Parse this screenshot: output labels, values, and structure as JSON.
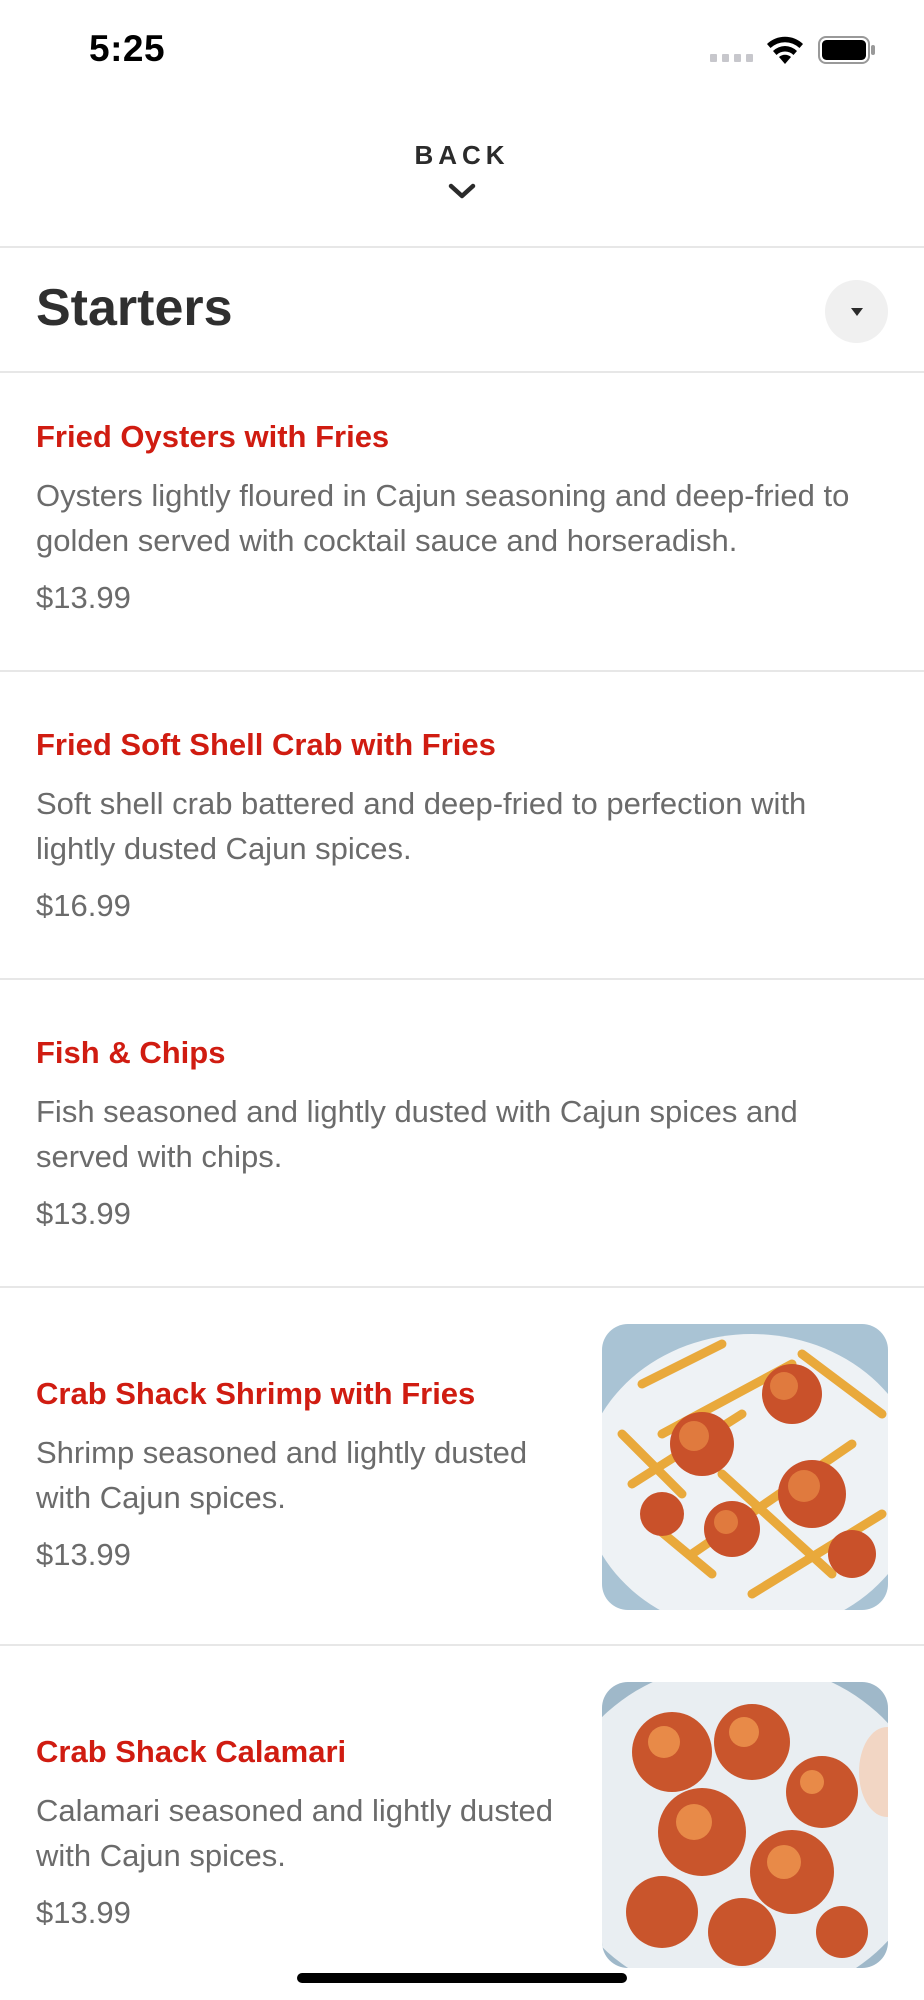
{
  "status_bar": {
    "time": "5:25"
  },
  "header": {
    "back_label": "BACK"
  },
  "section": {
    "title": "Starters"
  },
  "items": [
    {
      "name": "Fried Oysters with Fries",
      "description": "Oysters lightly floured in Cajun seasoning and deep-fried to golden served with cocktail sauce and horseradish.",
      "price": "$13.99"
    },
    {
      "name": "Fried Soft Shell Crab with Fries",
      "description": "Soft shell crab battered and deep-fried to perfection with lightly dusted Cajun spices.",
      "price": "$16.99"
    },
    {
      "name": "Fish & Chips",
      "description": "Fish seasoned and lightly dusted with Cajun spices and served with chips.",
      "price": "$13.99"
    },
    {
      "name": "Crab Shack Shrimp with Fries",
      "description": "Shrimp seasoned and lightly dusted with Cajun spices.",
      "price": "$13.99"
    },
    {
      "name": "Crab Shack Calamari",
      "description": "Calamari seasoned and lightly dusted with Cajun spices.",
      "price": "$13.99"
    }
  ],
  "colors": {
    "item_name": "#d01c11",
    "body_text": "#6b6b6b",
    "title_text": "#2f2f2f"
  }
}
